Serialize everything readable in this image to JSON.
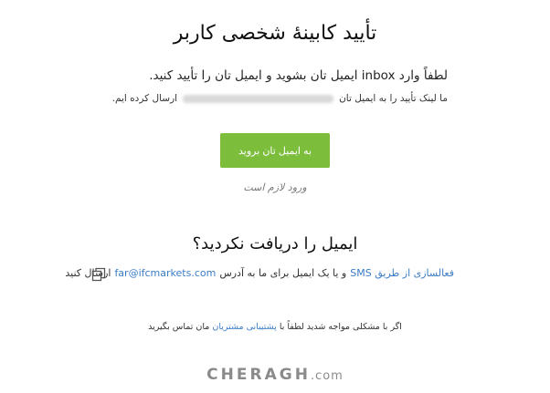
{
  "page": {
    "title": "تأیید کابینهٔ شخصی کاربر",
    "instruction": "لطفاً وارد inbox ایمیل تان بشوید و ایمیل تان را تأیید کنید.",
    "sent_prefix": "ما لینک تأیید را به ایمیل تان",
    "sent_suffix": "ارسال کرده ایم.",
    "go_button_label": "به ایمیل تان بروید",
    "login_required": "ورود لازم است",
    "not_received_heading": "ایمیل را دریافت نکردید؟",
    "options": {
      "sms_link": "فعالسازی از طریق SMS",
      "middle_text": "و یا یک ایمیل برای ما به آدرس",
      "email_link": "far@ifcmarkets.com",
      "end_text": "ارسال کنید"
    },
    "support": {
      "prefix": "اگر با مشکلی مواجه شدید لطفاً با",
      "link": "پشتیبانی مشتریان",
      "suffix": "مان تماس بگیرید"
    },
    "watermark": {
      "brand": "CHERAGH",
      "domain": ".com"
    }
  },
  "colors": {
    "button_green": "#7cbd3c",
    "link_blue": "#3b7dc6"
  },
  "icons": {
    "copy": "copy-icon"
  }
}
